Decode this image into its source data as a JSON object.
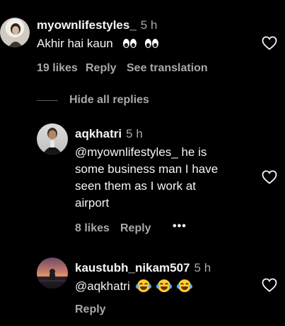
{
  "comments": [
    {
      "username": "myownlifestyles_",
      "time": "5 h",
      "text": "Akhir hai kaun",
      "emojis": [
        "eyes-emoji",
        "eyes-emoji"
      ],
      "likes": "19 likes",
      "reply": "Reply",
      "see_translation": "See translation"
    }
  ],
  "hide_replies": "Hide all replies",
  "replies": [
    {
      "username": "aqkhatri",
      "time": "5 h",
      "text_lines": [
        "@myownlifestyles_ he is",
        "some business man I have",
        "seen them as I work at",
        "airport"
      ],
      "likes": "8 likes",
      "reply": "Reply",
      "more": "•••"
    },
    {
      "username": "kaustubh_nikam507",
      "time": "5 h",
      "text": "@aqkhatri",
      "emojis": [
        "tears-of-joy-emoji",
        "tears-of-joy-emoji",
        "tears-of-joy-emoji"
      ],
      "reply": "Reply"
    }
  ],
  "colors": {
    "background": "#000000",
    "primary_text": "#f5f5f5",
    "secondary_text": "#a8a8a8"
  }
}
